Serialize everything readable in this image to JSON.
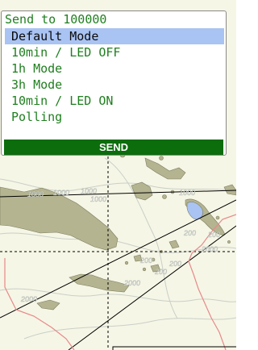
{
  "dialog": {
    "title": "Send to 100000",
    "modes": [
      {
        "label": "Default Mode",
        "selected": true
      },
      {
        "label": "10min / LED OFF",
        "selected": false
      },
      {
        "label": "1h Mode",
        "selected": false
      },
      {
        "label": "3h Mode",
        "selected": false
      },
      {
        "label": "10min / LED ON",
        "selected": false
      },
      {
        "label": "Polling",
        "selected": false
      }
    ],
    "send_label": "SEND"
  },
  "map": {
    "contour_labels": [
      "1000",
      "1000",
      "1000",
      "1000",
      "200",
      "200",
      "200",
      "200",
      "2000",
      "200",
      "1000",
      "2000",
      "2000"
    ],
    "colors": {
      "sea": "#f6f6e6",
      "land": "#b4b491",
      "highlight": "#a9c3f3",
      "route": "#e7898a",
      "send_button": "#0b6d0b",
      "text_green": "#1f7f1f"
    }
  }
}
